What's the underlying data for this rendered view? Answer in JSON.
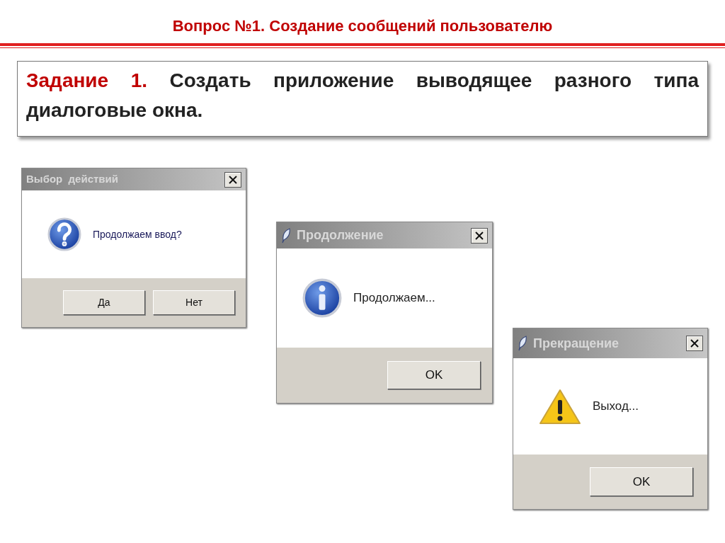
{
  "slide_title": "Вопрос №1. Создание сообщений пользователю",
  "task": {
    "label": "Задание 1.",
    "text": "Создать приложение выводящее разного типа диалоговые окна."
  },
  "dialogs": [
    {
      "kind": "question",
      "title": "Выбор  действий",
      "app_icon": false,
      "message": "Продолжаем ввод?",
      "buttons": [
        "Да",
        "Нет"
      ]
    },
    {
      "kind": "info",
      "title": "Продолжение",
      "app_icon": true,
      "message": "Продолжаем...",
      "buttons": [
        "OK"
      ]
    },
    {
      "kind": "warning",
      "title": "Прекращение",
      "app_icon": true,
      "message": "Выход...",
      "buttons": [
        "OK"
      ]
    }
  ]
}
